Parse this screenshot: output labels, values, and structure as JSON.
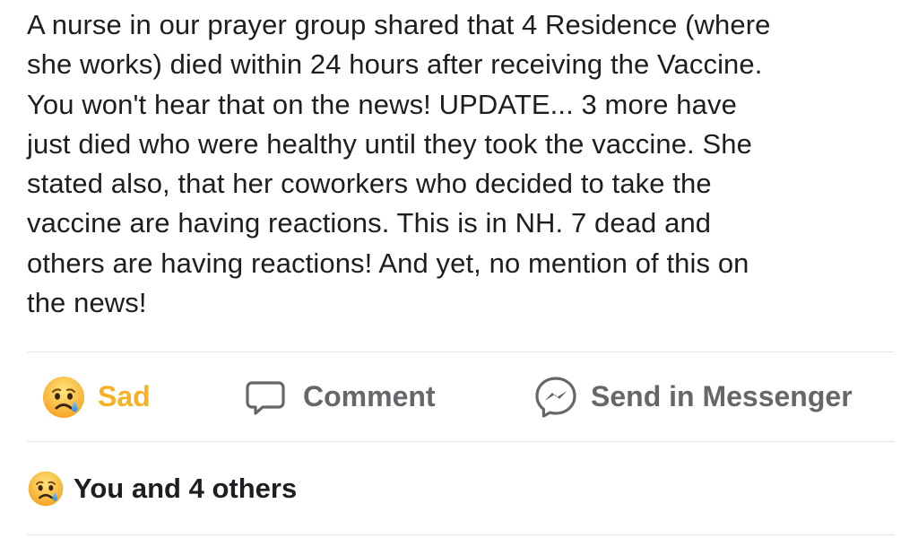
{
  "post": {
    "lines": [
      "A nurse in our prayer group shared that 4 Residence (where",
      "she works) died within 24 hours after receiving the Vaccine.",
      "You won't hear that on the news! UPDATE... 3 more have",
      "just died who were healthy until they took the vaccine. She",
      "stated also, that her coworkers who decided to take the",
      "vaccine are having reactions. This is in NH. 7 dead and",
      "others are having reactions! And yet, no mention of this on",
      "the news!"
    ]
  },
  "actions": {
    "sad": {
      "label": "Sad",
      "icon": "sad-emoji-icon",
      "color": "#f7b125"
    },
    "comment": {
      "label": "Comment",
      "icon": "comment-bubble-icon"
    },
    "messenger": {
      "label": "Send in Messenger",
      "icon": "messenger-icon"
    }
  },
  "reactions_summary": {
    "label": "You and 4 others",
    "icon": "sad-emoji-icon"
  },
  "colors": {
    "text": "#1c1e21",
    "muted": "#65676b",
    "sad_accent": "#f7b125",
    "divider": "#e4e6ea"
  }
}
